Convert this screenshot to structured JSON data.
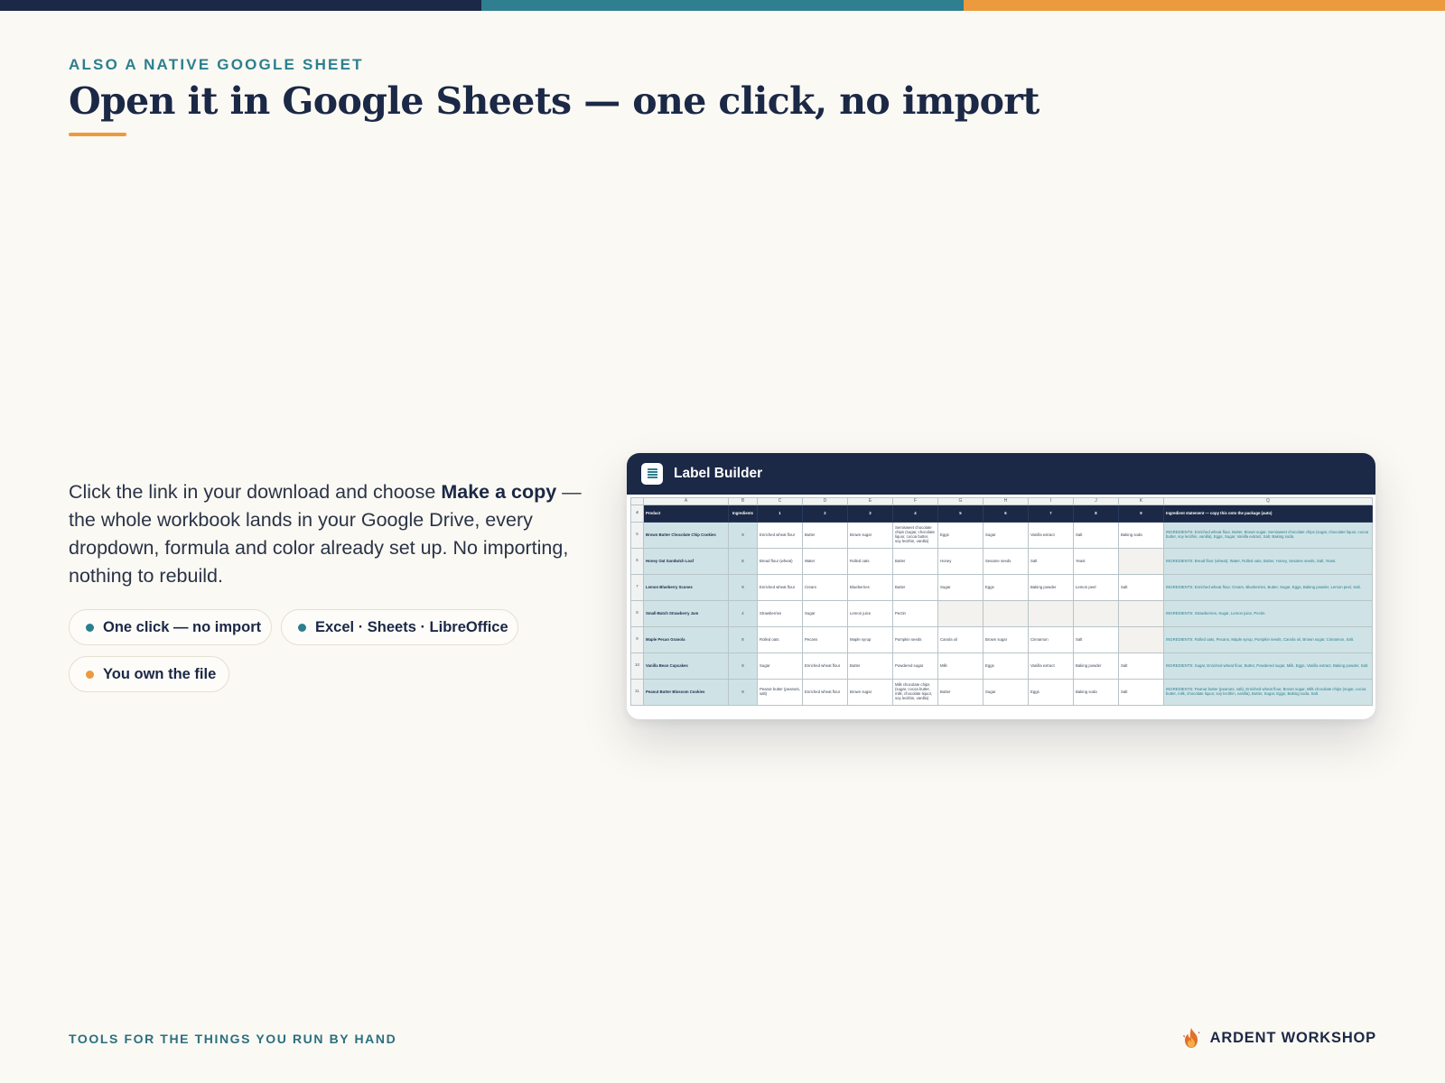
{
  "eyebrow": "ALSO A NATIVE GOOGLE SHEET",
  "title": "Open it in Google Sheets — one click, no import",
  "body": {
    "before": "Click the link in your download and choose ",
    "bold": "Make a copy",
    "after": " — the whole workbook lands in your Google Drive, every dropdown, formula and color already set up. No importing, nothing to rebuild."
  },
  "pills": [
    {
      "label": "One click — no import",
      "dot_color": "#2b7f8f"
    },
    {
      "label": "Excel · Sheets · LibreOffice",
      "dot_color": "#2b7f8f"
    },
    {
      "label": "You own the file",
      "dot_color": "#eb9a3e"
    }
  ],
  "window": {
    "title": "Label Builder",
    "icon": "spreadsheet-icon"
  },
  "sheet": {
    "column_letters": [
      "A",
      "B",
      "C",
      "D",
      "E",
      "F",
      "G",
      "H",
      "I",
      "J",
      "K",
      "Q"
    ],
    "header_row_number": "4",
    "headers": [
      "Product",
      "Ingredients",
      "1",
      "2",
      "3",
      "4",
      "5",
      "6",
      "7",
      "8",
      "9",
      "Ingredient statement — copy this onto the package (auto)"
    ],
    "rows": [
      {
        "num": "5",
        "product": "Brown Butter Chocolate Chip Cookies",
        "count": "9",
        "cells": [
          "Enriched wheat flour",
          "Butter",
          "Brown sugar",
          "Semisweet chocolate chips (sugar, chocolate liquor, cocoa butter, soy lecithin, vanilla)",
          "Eggs",
          "Sugar",
          "Vanilla extract",
          "Salt",
          "Baking soda"
        ],
        "statement": "INGREDIENTS: Enriched wheat flour, Butter, Brown sugar, Semisweet chocolate chips (sugar, chocolate liquor, cocoa butter, soy lecithin, vanilla), Eggs, Sugar, Vanilla extract, Salt, Baking soda."
      },
      {
        "num": "6",
        "product": "Honey Oat Sandwich Loaf",
        "count": "8",
        "cells": [
          "Bread flour (wheat)",
          "Water",
          "Rolled oats",
          "Butter",
          "Honey",
          "Sesame seeds",
          "Salt",
          "Yeast",
          ""
        ],
        "statement": "INGREDIENTS: Bread flour (wheat), Water, Rolled oats, Butter, Honey, Sesame seeds, Salt, Yeast."
      },
      {
        "num": "7",
        "product": "Lemon Blueberry Scones",
        "count": "9",
        "cells": [
          "Enriched wheat flour",
          "Cream",
          "Blueberries",
          "Butter",
          "Sugar",
          "Eggs",
          "Baking powder",
          "Lemon peel",
          "Salt"
        ],
        "statement": "INGREDIENTS: Enriched wheat flour, Cream, Blueberries, Butter, Sugar, Eggs, Baking powder, Lemon peel, Salt."
      },
      {
        "num": "8",
        "product": "Small-Batch Strawberry Jam",
        "count": "4",
        "cells": [
          "Strawberries",
          "Sugar",
          "Lemon juice",
          "Pectin",
          "",
          "",
          "",
          "",
          ""
        ],
        "statement": "INGREDIENTS: Strawberries, Sugar, Lemon juice, Pectin."
      },
      {
        "num": "9",
        "product": "Maple Pecan Granola",
        "count": "8",
        "cells": [
          "Rolled oats",
          "Pecans",
          "Maple syrup",
          "Pumpkin seeds",
          "Canola oil",
          "Brown sugar",
          "Cinnamon",
          "Salt",
          ""
        ],
        "statement": "INGREDIENTS: Rolled oats, Pecans, Maple syrup, Pumpkin seeds, Canola oil, Brown sugar, Cinnamon, Salt."
      },
      {
        "num": "10",
        "product": "Vanilla Bean Cupcakes",
        "count": "9",
        "cells": [
          "Sugar",
          "Enriched wheat flour",
          "Butter",
          "Powdered sugar",
          "Milk",
          "Eggs",
          "Vanilla extract",
          "Baking powder",
          "Salt"
        ],
        "statement": "INGREDIENTS: Sugar, Enriched wheat flour, Butter, Powdered sugar, Milk, Eggs, Vanilla extract, Baking powder, Salt."
      },
      {
        "num": "11",
        "product": "Peanut Butter Blossom Cookies",
        "count": "9",
        "cells": [
          "Peanut butter (peanuts, salt)",
          "Enriched wheat flour",
          "Brown sugar",
          "Milk chocolate chips (sugar, cocoa butter, milk, chocolate liquor, soy lecithin, vanilla)",
          "Butter",
          "Sugar",
          "Eggs",
          "Baking soda",
          "Salt"
        ],
        "statement": "INGREDIENTS: Peanut butter (peanuts, salt), Enriched wheat flour, Brown sugar, Milk chocolate chips (sugar, cocoa butter, milk, chocolate liquor, soy lecithin, vanilla), Butter, Sugar, Eggs, Baking soda, Salt."
      }
    ]
  },
  "footer": {
    "tagline": "TOOLS FOR THE THINGS YOU RUN BY HAND",
    "brand": "ARDENT WORKSHOP",
    "brand_icon": "flame-icon"
  },
  "colors": {
    "navy": "#1b2846",
    "teal": "#2f7f90",
    "orange": "#eb9a3e",
    "background": "#fbf9f3"
  }
}
